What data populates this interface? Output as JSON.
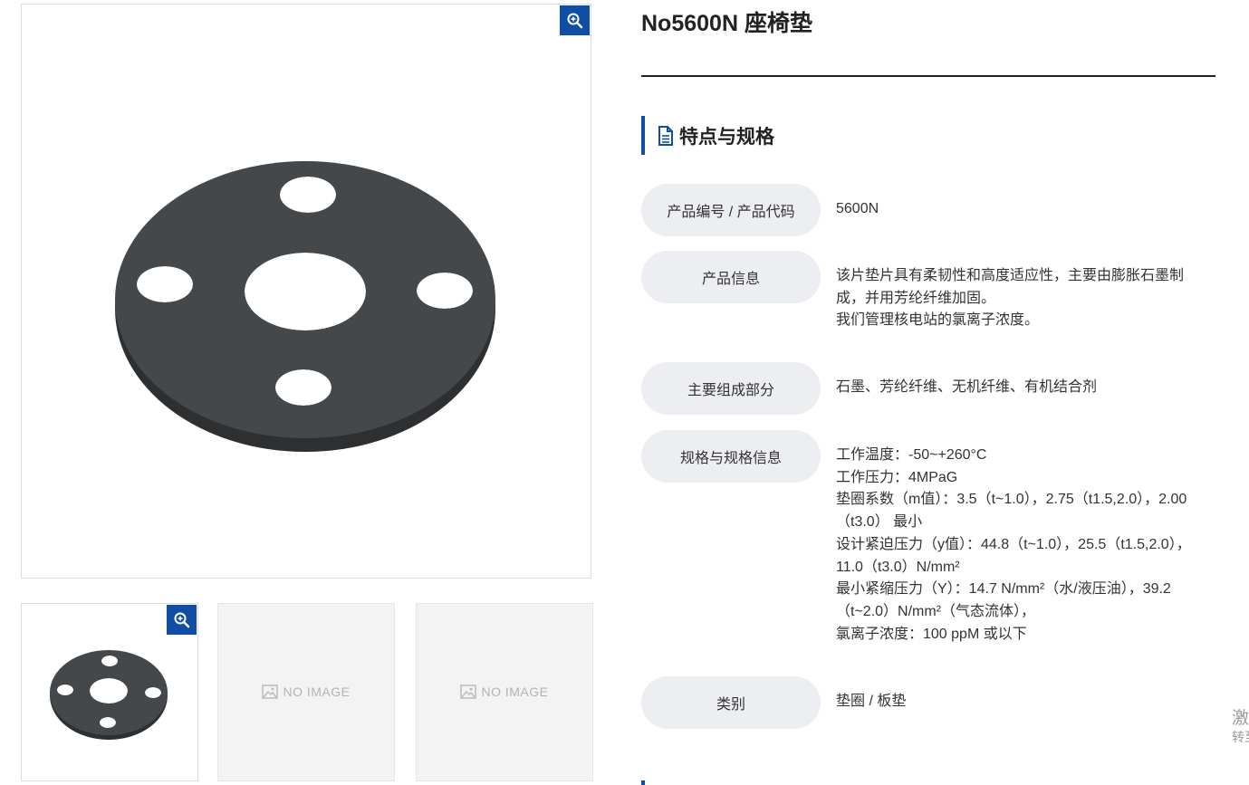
{
  "product": {
    "title": "No5600N 座椅垫"
  },
  "gallery": {
    "no_image_label": "NO IMAGE",
    "zoom_icon": "zoom-in-icon",
    "accent_color": "#0f4ea3"
  },
  "section": {
    "heading": "特点与规格",
    "icon": "document-icon"
  },
  "specs": [
    {
      "label": "产品编号 / 产品代码",
      "lines": [
        "5600N"
      ]
    },
    {
      "label": "产品信息",
      "lines": [
        "该片垫片具有柔韧性和高度适应性，主要由膨胀石墨制成，并用芳纶纤维加固。",
        "我们管理核电站的氯离子浓度。"
      ]
    },
    {
      "label": "主要组成部分",
      "lines": [
        "石墨、芳纶纤维、无机纤维、有机结合剂"
      ]
    },
    {
      "label": "规格与规格信息",
      "lines": [
        "工作温度：-50~+260°C",
        "工作压力：4MPaG",
        "垫圈系数（m值）：3.5（t~1.0），2.75（t1.5,2.0），2.00（t3.0） 最小",
        "设计紧迫压力（y值）：44.8（t~1.0），25.5（t1.5,2.0），11.0（t3.0）N/mm²",
        "最小紧缩压力（Y）：14.7 N/mm²（水/液压油），39.2（t~2.0）N/mm²（气态流体），",
        "氯离子浓度：100 ppM 或以下"
      ]
    },
    {
      "label": "类别",
      "lines": [
        "垫圈 / 板垫"
      ]
    }
  ],
  "side": {
    "line1": "激",
    "line2": "转至"
  }
}
